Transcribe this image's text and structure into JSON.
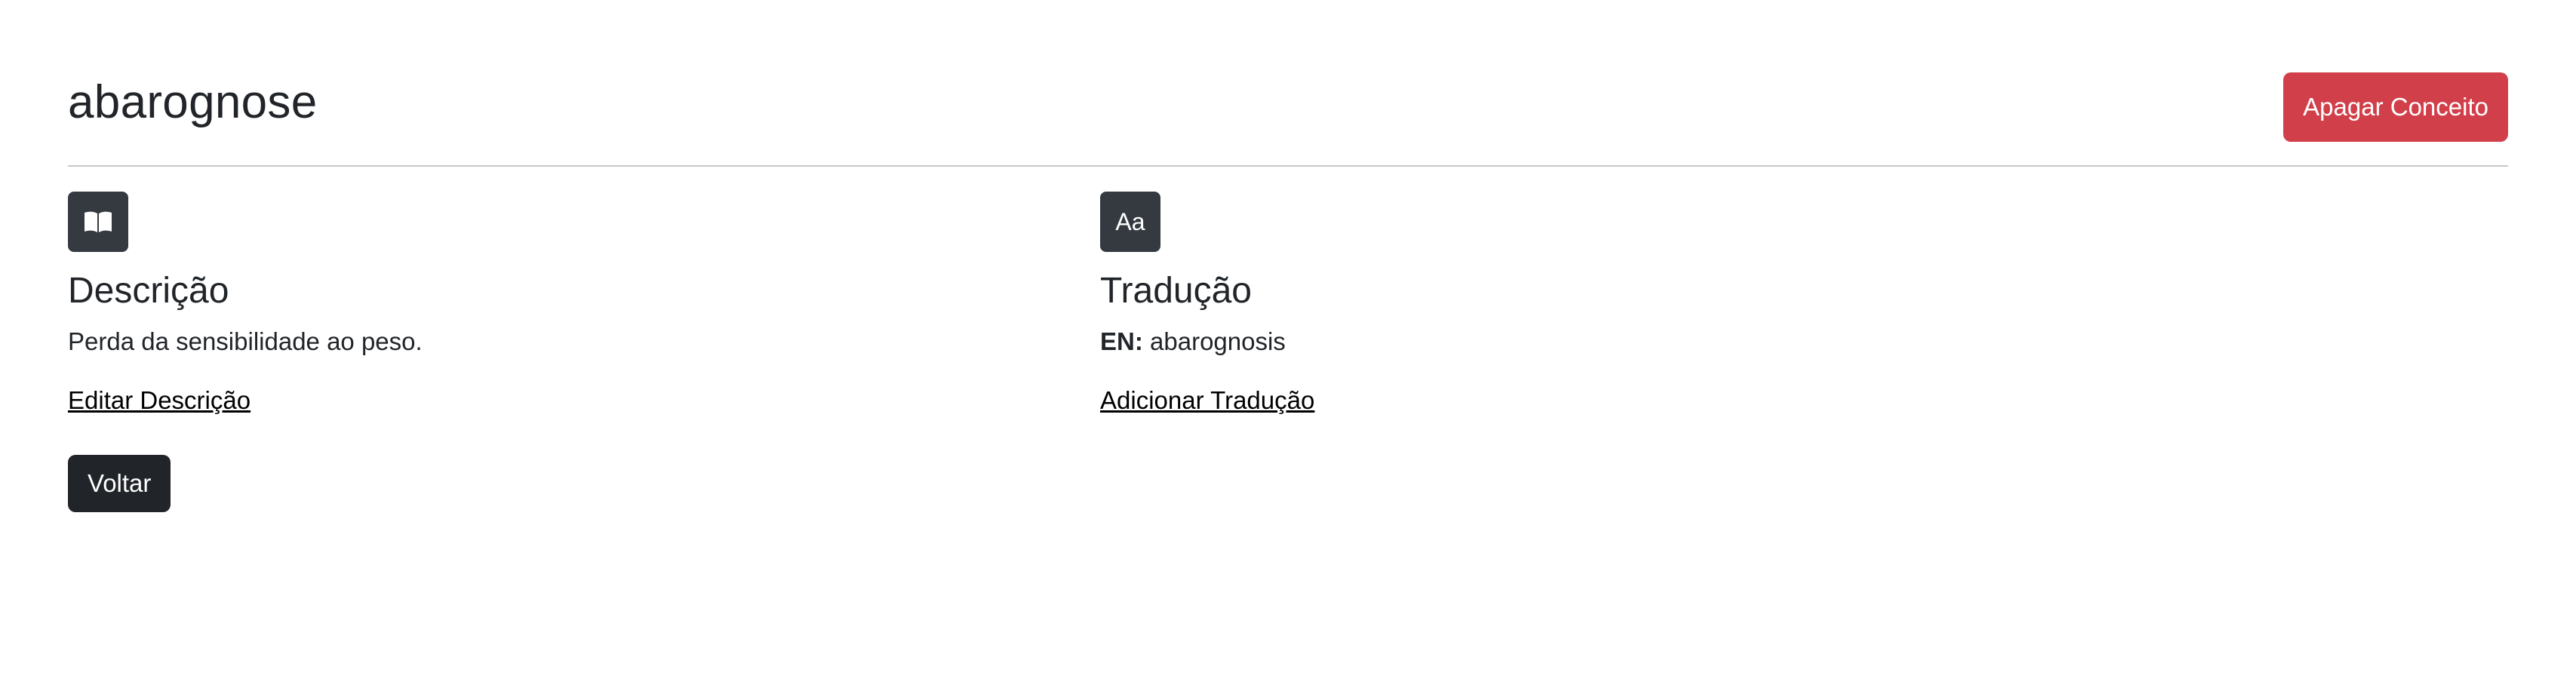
{
  "page": {
    "title": "abarognose"
  },
  "header": {
    "delete_button_label": "Apagar Conceito"
  },
  "description": {
    "icon": "book-open-icon",
    "title": "Descrição",
    "text": "Perda da sensibilidade ao peso.",
    "edit_link_label": "Editar Descrição"
  },
  "translation": {
    "icon_text": "Aa",
    "title": "Tradução",
    "entries": [
      {
        "lang": "EN:",
        "text": "abarognosis"
      }
    ],
    "add_link_label": "Adicionar Tradução"
  },
  "footer": {
    "back_button_label": "Voltar"
  },
  "colors": {
    "danger": "#d1404a",
    "dark": "#212529",
    "icon_bg": "#343a40",
    "divider": "#c7c9cc"
  }
}
